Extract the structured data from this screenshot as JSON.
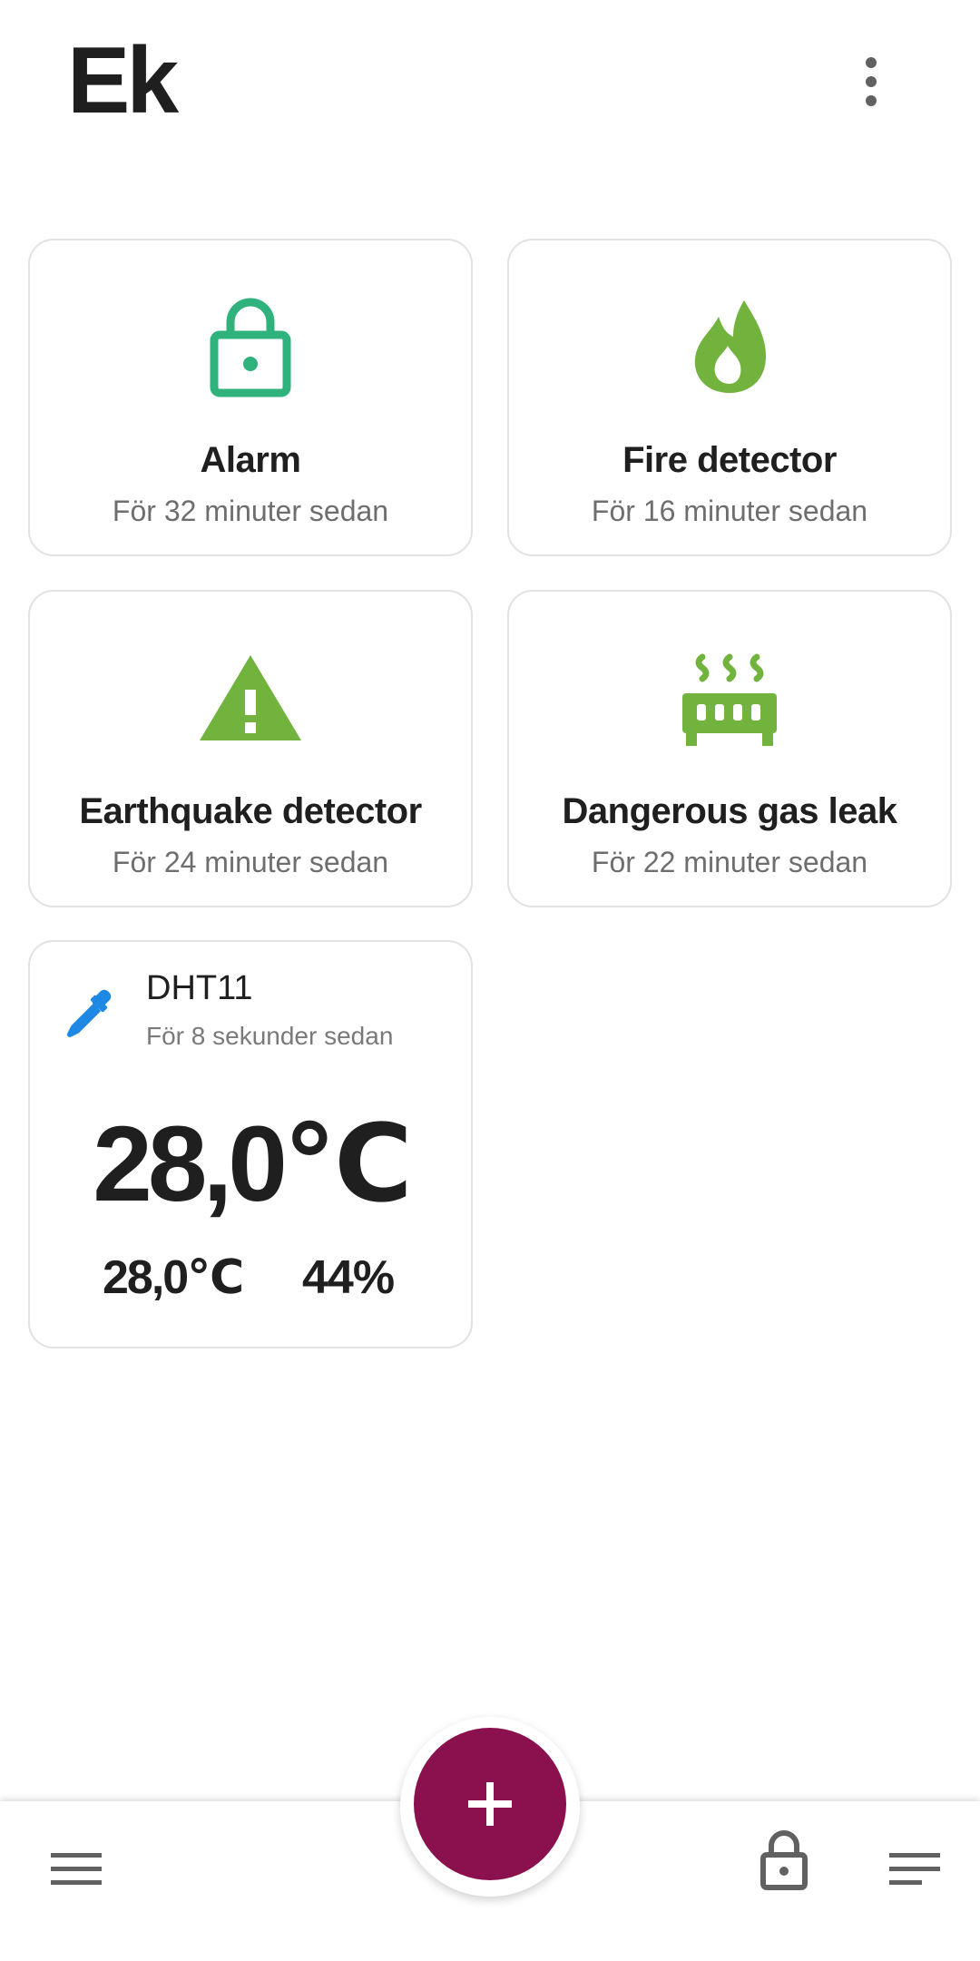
{
  "header": {
    "title": "Ek",
    "menu_icon": "more-vert-icon"
  },
  "tiles": [
    {
      "name": "Alarm",
      "time": "För 32 minuter sedan",
      "icon": "lock-icon",
      "icon_color": "#2fb27b"
    },
    {
      "name": "Fire detector",
      "time": "För 16 minuter sedan",
      "icon": "flame-icon",
      "icon_color": "#72b33e"
    },
    {
      "name": "Earthquake detector",
      "time": "För 24 minuter sedan",
      "icon": "warning-icon",
      "icon_color": "#72b33e"
    },
    {
      "name": "Dangerous gas leak",
      "time": "För 22 minuter sedan",
      "icon": "radiator-icon",
      "icon_color": "#72b33e"
    }
  ],
  "sensor": {
    "name": "DHT11",
    "time": "För 8 sekunder sedan",
    "main_value": "28,0℃",
    "temperature": "28,0℃",
    "humidity": "44%",
    "icon": "eyedropper-icon",
    "icon_color": "#1e88e5"
  },
  "fab": {
    "icon": "plus-icon",
    "color": "#8b104e"
  },
  "bottom_nav": {
    "left_icon": "hamburger-menu-icon",
    "lock_icon": "lock-icon",
    "right_icon": "sort-lines-icon"
  }
}
